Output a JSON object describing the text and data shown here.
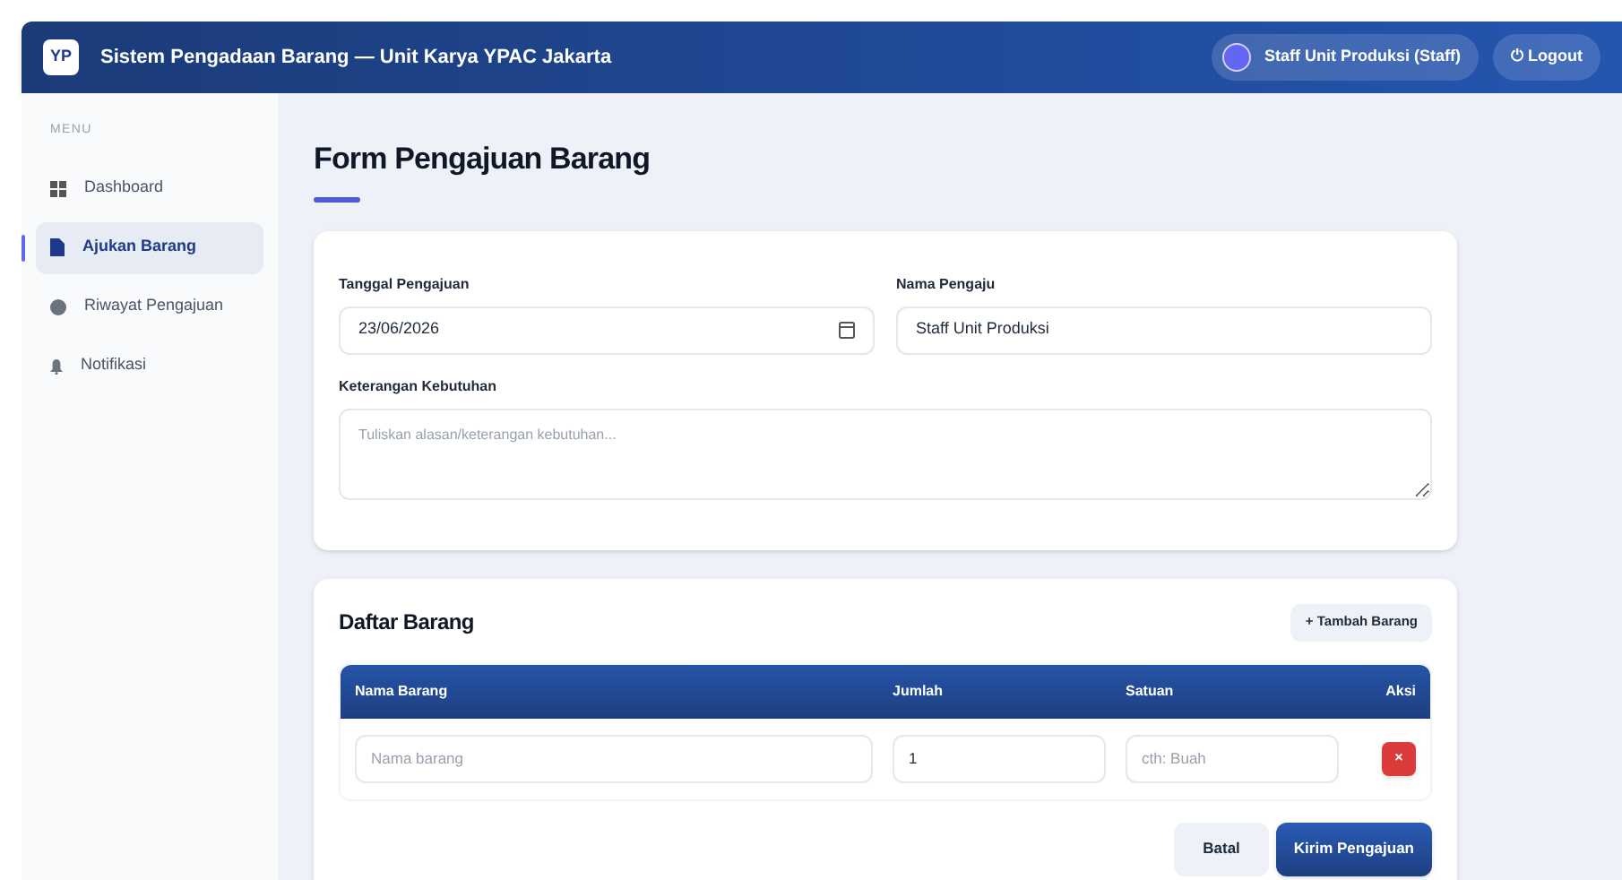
{
  "header": {
    "logo": "YP",
    "title": "Sistem Pengadaan Barang — Unit Karya YPAC Jakarta",
    "user": "Staff Unit Produksi (Staff)",
    "logout": "⏻ Logout"
  },
  "sidebar": {
    "heading": "MENU",
    "items": [
      {
        "label": "Dashboard",
        "selected": false
      },
      {
        "label": "Ajukan Barang",
        "selected": true
      },
      {
        "label": "Riwayat Pengajuan",
        "selected": false
      },
      {
        "label": "Notifikasi",
        "selected": false
      }
    ]
  },
  "page_title": "Form Pengajuan Barang",
  "form": {
    "date_label": "Tanggal Pengajuan",
    "date_value": "23/06/2026",
    "name_label": "Nama Pengaju",
    "name_value": "Staff Unit Produksi",
    "notes_label": "Keterangan Kebutuhan",
    "notes_placeholder": "Tuliskan alasan/keterangan kebutuhan..."
  },
  "items": {
    "title": "Daftar Barang",
    "add_button": "+ Tambah Barang",
    "columns": [
      "Nama Barang",
      "Jumlah",
      "Satuan",
      "Aksi"
    ],
    "rows": [
      {
        "name_placeholder": "Nama barang",
        "qty": "1",
        "unit_placeholder": "cth: Buah",
        "delete": "×"
      }
    ]
  },
  "buttons": {
    "cancel": "Batal",
    "submit": "Kirim Pengajuan"
  }
}
